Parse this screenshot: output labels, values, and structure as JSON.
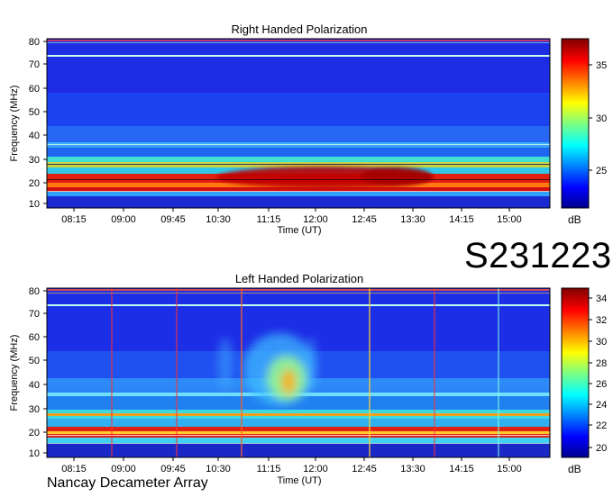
{
  "identifier": "S231223",
  "footer": "Nancay Decameter Array",
  "chart_data": [
    {
      "type": "heatmap",
      "title": "Right Handed Polarization",
      "xlabel": "Time (UT)",
      "ylabel": "Frequency (MHz)",
      "x_ticks": [
        "08:15",
        "09:00",
        "09:45",
        "10:30",
        "11:15",
        "12:00",
        "12:45",
        "13:30",
        "14:15",
        "15:00"
      ],
      "x_range": [
        "07:47",
        "15:42"
      ],
      "y_ticks": [
        10,
        20,
        30,
        40,
        50,
        60,
        70,
        80
      ],
      "ylim": [
        9,
        81
      ],
      "colorbar": {
        "label": "dB",
        "ticks": [
          25,
          30,
          35
        ],
        "range": [
          21.5,
          37.5
        ]
      },
      "colormap": [
        "#00008f",
        "#0000ff",
        "#0080ff",
        "#00ffff",
        "#80ff80",
        "#ffff00",
        "#ff8000",
        "#ff0000",
        "#800000"
      ]
    },
    {
      "type": "heatmap",
      "title": "Left Handed Polarization",
      "xlabel": "Time (UT)",
      "ylabel": "Frequency (MHz)",
      "x_ticks": [
        "08:15",
        "09:00",
        "09:45",
        "10:30",
        "11:15",
        "12:00",
        "12:45",
        "13:30",
        "14:15",
        "15:00"
      ],
      "x_range": [
        "07:47",
        "15:42"
      ],
      "y_ticks": [
        10,
        20,
        30,
        40,
        50,
        60,
        70,
        80
      ],
      "ylim": [
        9,
        81
      ],
      "colorbar": {
        "label": "dB",
        "ticks": [
          20,
          22,
          24,
          26,
          28,
          30,
          32,
          34
        ],
        "range": [
          19.5,
          35
        ]
      },
      "colormap": [
        "#00008f",
        "#0000ff",
        "#0080ff",
        "#00ffff",
        "#80ff80",
        "#ffff00",
        "#ff8000",
        "#ff0000",
        "#800000"
      ]
    }
  ]
}
